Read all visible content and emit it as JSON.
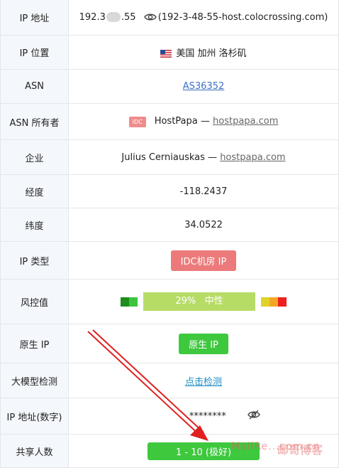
{
  "rows": {
    "ip": {
      "label": "IP 地址",
      "prefix": "192.3",
      "suffix": ".55",
      "host": "(192-3-48-55-host.colocrossing.com)"
    },
    "location": {
      "label": "IP 位置",
      "value": "美国 加州 洛杉矶",
      "flag": "us-flag-icon"
    },
    "asn": {
      "label": "ASN",
      "value": "AS36352"
    },
    "asn_owner": {
      "label": "ASN 所有者",
      "badge": "IDC",
      "name": "HostPapa —",
      "link": "hostpapa.com"
    },
    "org": {
      "label": "企业",
      "name": "Julius Cerniauskas —",
      "link": "hostpapa.com"
    },
    "longitude": {
      "label": "经度",
      "value": "-118.2437"
    },
    "latitude": {
      "label": "纬度",
      "value": "34.0522"
    },
    "ip_type": {
      "label": "IP 类型",
      "value": "IDC机房 IP"
    },
    "risk": {
      "label": "风控值",
      "score_text": "29%",
      "level": "中性",
      "score": 29
    },
    "native_ip": {
      "label": "原生 IP",
      "value": "原生 IP"
    },
    "llm_check": {
      "label": "大模型检测",
      "value": "点击检测"
    },
    "ip_numeric": {
      "label": "IP 地址(数字)",
      "value": "********"
    },
    "shared_users": {
      "label": "共享人数",
      "value": "1 - 10 (极好)"
    }
  },
  "watermark": {
    "text": "MailRe...com.cn",
    "brand": "邮哥博客"
  },
  "colors": {
    "link": "#3b6fc4",
    "idc": "#ef8c8c",
    "native": "#3ec83e",
    "risk": "#b7dc66",
    "arrow": "#e02020"
  }
}
